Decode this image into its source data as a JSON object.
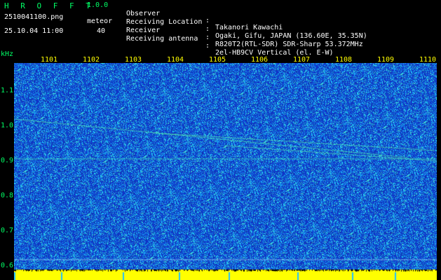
{
  "header": {
    "title": "H R O F F T",
    "version": "1.0.0",
    "filename": "2510041100.png",
    "datetime": "25.10.04 11:00",
    "detection_label": "meteor",
    "detection_count": "40"
  },
  "info": [
    {
      "label": "Observer",
      "value": "Takanori Kawachi"
    },
    {
      "label": "Receiving Location",
      "value": "Ogaki, Gifu, JAPAN (136.60E, 35.35N)"
    },
    {
      "label": "Receiver",
      "value": "R820T2(RTL-SDR) SDR-Sharp 53.372MHz"
    },
    {
      "label": "Receiving antenna",
      "value": "2el-HB9CV Vertical (el. E-W)"
    }
  ],
  "y_axis": {
    "unit": "kHz",
    "ticks": [
      "1.1",
      "1.0",
      "0.9",
      "0.8",
      "0.7",
      "0.6"
    ]
  },
  "x_axis": {
    "ticks": [
      "1101",
      "1102",
      "1103",
      "1104",
      "1105",
      "1106",
      "1107",
      "1108",
      "1109",
      "1110"
    ]
  },
  "colors": {
    "background": "#000000",
    "spectrogram_base": "#1030c8",
    "noise_bright": "#20c0ff",
    "signal": "#40ffa0",
    "label_green": "#00ff66",
    "tick_yellow": "#ffff00",
    "strip_yellow": "#ffff00"
  }
}
